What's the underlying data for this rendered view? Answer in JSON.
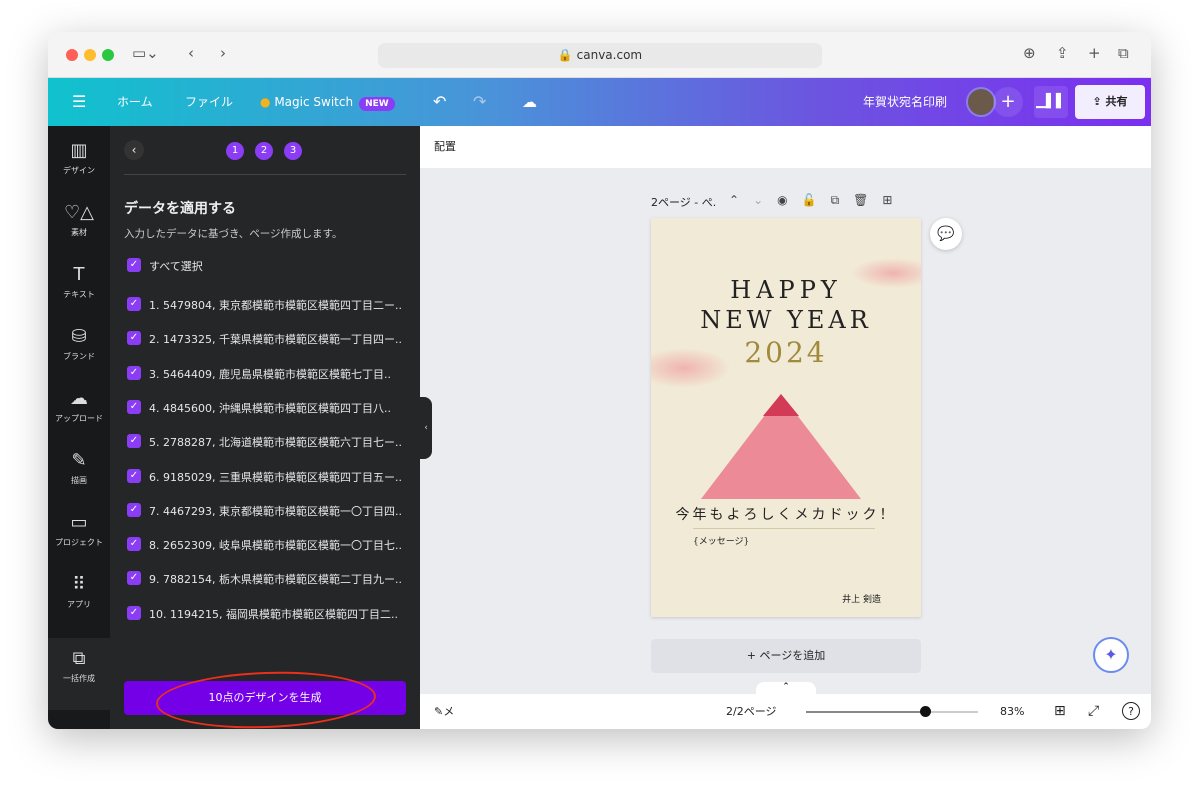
{
  "browser": {
    "url": "canva.com"
  },
  "header": {
    "home": "ホーム",
    "file": "ファイル",
    "magic_switch": "Magic Switch",
    "new_badge": "NEW",
    "doc_title": "年賀状宛名印刷",
    "share": "共有"
  },
  "rail": [
    {
      "label": "デザイン",
      "icon": "▥"
    },
    {
      "label": "素材",
      "icon": "♡△"
    },
    {
      "label": "テキスト",
      "icon": "T"
    },
    {
      "label": "ブランド",
      "icon": "⛁"
    },
    {
      "label": "アップロード",
      "icon": "☁"
    },
    {
      "label": "描画",
      "icon": "✎"
    },
    {
      "label": "プロジェクト",
      "icon": "▭"
    },
    {
      "label": "アプリ",
      "icon": "⠿"
    },
    {
      "label": "一括作成",
      "icon": "⧉"
    }
  ],
  "panel": {
    "steps": [
      "1",
      "2",
      "3"
    ],
    "title": "データを適用する",
    "subtitle": "入力したデータに基づき、ページ作成します。",
    "select_all": "すべて選択",
    "items": [
      "1. 5479804, 東京都模範市模範区模範四丁目二ー..",
      "2. 1473325, 千葉県模範市模範区模範一丁目四ー..",
      "3. 5464409, 鹿児島県模範市模範区模範七丁目..",
      "4. 4845600, 沖縄県模範市模範区模範四丁目八..",
      "5. 2788287, 北海道模範市模範区模範六丁目七ー..",
      "6. 9185029, 三重県模範市模範区模範四丁目五ー..",
      "7. 4467293, 東京都模範市模範区模範一〇丁目四..",
      "8. 2652309, 岐阜県模範市模範区模範一〇丁目七..",
      "9. 7882154, 栃木県模範市模範区模範二丁目九ー..",
      "10. 1194215, 福岡県模範市模範区模範四丁目二.."
    ],
    "generate": "10点のデザインを生成"
  },
  "canvas": {
    "topbar": "配置",
    "page_label": "2ページ - ぺ.",
    "add_page": "+ ページを追加"
  },
  "card": {
    "line1": "HAPPY",
    "line2": "NEW YEAR",
    "year": "2024",
    "greeting": "今年もよろしくメカドック！",
    "message": "{メッセージ}",
    "name": "井上 剣造"
  },
  "bottom": {
    "notes": "メモ",
    "pages": "2/2ページ",
    "zoom": "83%",
    "zoom_percent": 83
  },
  "colors": {
    "accent": "#8b3df5",
    "generate": "#7300e6",
    "card": "#f1ead6"
  }
}
